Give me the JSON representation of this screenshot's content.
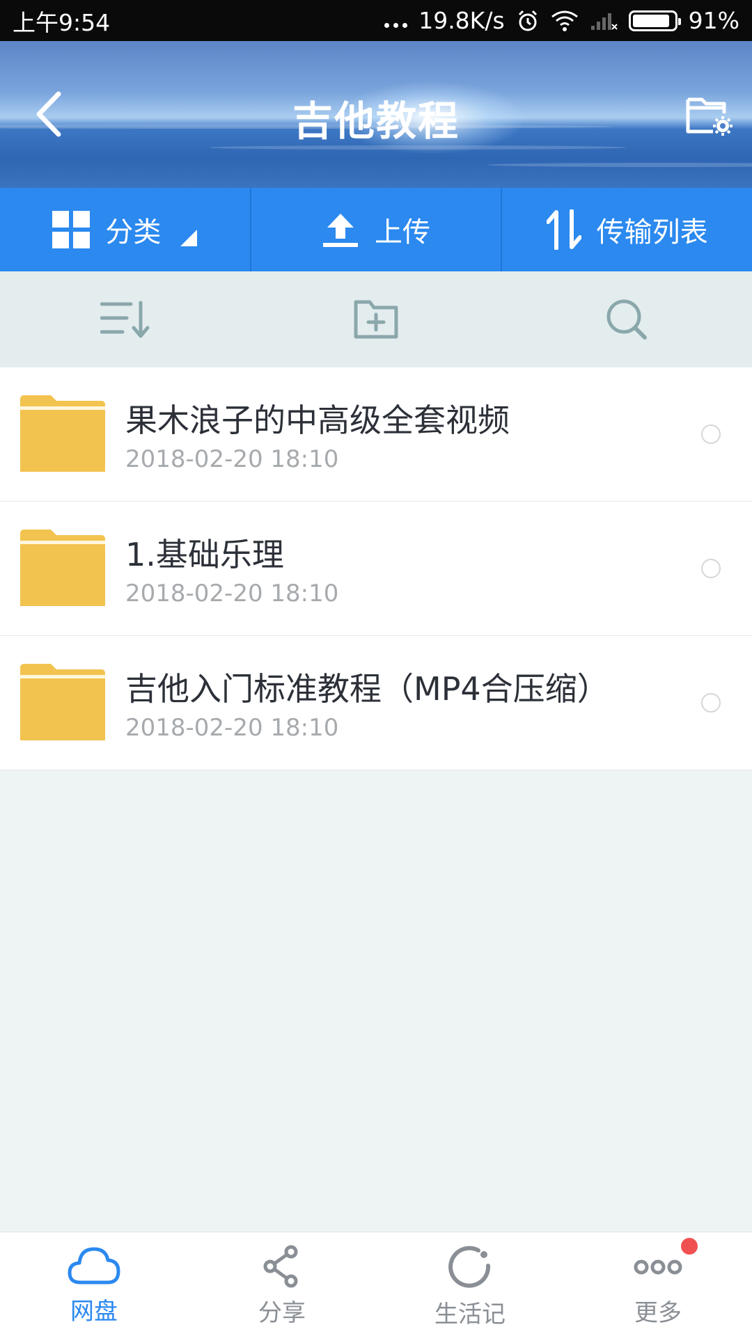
{
  "status_bar": {
    "time": "上午9:54",
    "speed": "19.8K/s",
    "battery": "91%",
    "battery_level": 0.91
  },
  "header": {
    "title": "吉他教程",
    "back_icon": "back-arrow-icon",
    "settings_icon": "folder-settings-icon"
  },
  "actions": {
    "category_label": "分类",
    "upload_label": "上传",
    "transfer_label": "传输列表"
  },
  "toolbar": {
    "sort_icon": "sort-icon",
    "new_folder_icon": "new-folder-icon",
    "search_icon": "search-icon"
  },
  "files": [
    {
      "name": "果木浪子的中高级全套视频",
      "date": "2018-02-20  18:10",
      "type": "folder"
    },
    {
      "name": "1.基础乐理",
      "date": "2018-02-20  18:10",
      "type": "folder"
    },
    {
      "name": "吉他入门标准教程（MP4合压缩）",
      "date": "2018-02-20  18:10",
      "type": "folder"
    }
  ],
  "bottom_nav": {
    "items": [
      {
        "label": "网盘",
        "icon": "cloud-icon",
        "active": true
      },
      {
        "label": "分享",
        "icon": "share-icon",
        "active": false
      },
      {
        "label": "生活记",
        "icon": "life-record-icon",
        "active": false
      },
      {
        "label": "更多",
        "icon": "more-icon",
        "active": false,
        "badge": true
      }
    ]
  },
  "colors": {
    "accent": "#2b89ef",
    "folder": "#f2c34f",
    "badge": "#f15050"
  }
}
